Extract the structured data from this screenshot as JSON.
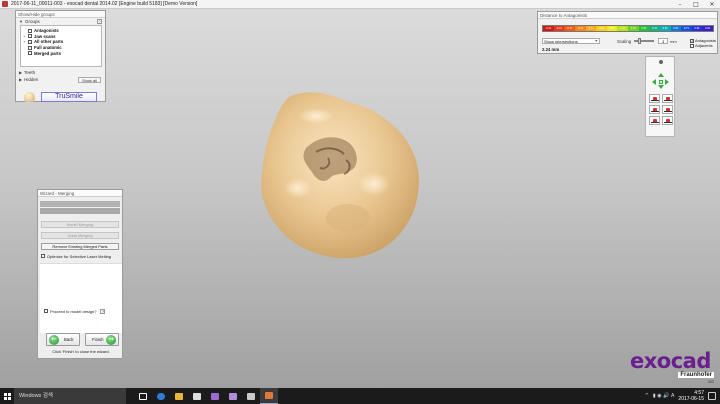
{
  "window": {
    "title": "2017-06-11_00011-003 - exocad dental 2014.02 [Engine build 5183] [Demo Version]",
    "minimize": "–",
    "maximize": "□",
    "close": "✕"
  },
  "showhide": {
    "title": "Show/Hide groups",
    "groups_label": "Groups",
    "help": "?",
    "groups": [
      {
        "label": "Antagonists",
        "expand": ""
      },
      {
        "label": "Jaw scans",
        "expand": "+"
      },
      {
        "label": "All other parts",
        "expand": "+"
      },
      {
        "label": "Full anatomic",
        "expand": ""
      },
      {
        "label": "Merged parts",
        "expand": ""
      }
    ],
    "teeth_label": "Teeth",
    "hidden_label": "Hidden",
    "show_all": "Show all",
    "trusmile": "TruSmile"
  },
  "distance": {
    "title": "Distance to Antagonists",
    "scale": [
      {
        "label": "-0.41",
        "color": "#d11818"
      },
      {
        "label": "-0.41",
        "color": "#e2361d"
      },
      {
        "label": "-0.31",
        "color": "#ef5a1c"
      },
      {
        "label": "-0.21",
        "color": "#f5831f"
      },
      {
        "label": "-0.11",
        "color": "#f8a81f"
      },
      {
        "label": "-0.01",
        "color": "#f6cd1e"
      },
      {
        "label": "0.01",
        "color": "#eeea1f"
      },
      {
        "label": "0.11",
        "color": "#b6e21f"
      },
      {
        "label": "0.21",
        "color": "#6fd02a"
      },
      {
        "label": "0.31",
        "color": "#27bf3d"
      },
      {
        "label": "0.41",
        "color": "#14b17a"
      },
      {
        "label": "0.51",
        "color": "#12a8b4"
      },
      {
        "label": "0.61",
        "color": "#1578d4"
      },
      {
        "label": "0.71",
        "color": "#1850e0"
      },
      {
        "label": "0.81",
        "color": "#2a2fe0"
      },
      {
        "label": "0.91",
        "color": "#3a1fc8"
      }
    ],
    "select_value": "Show intersections",
    "scaling_label": "Scaling",
    "scaling_value": "3",
    "unit": "mm",
    "scaling_fraction": 0.25,
    "antagonists": "Antagonists",
    "adjacents": "Adjacents",
    "check_mark": "✓",
    "distance_value": "2.24 mm"
  },
  "wizard": {
    "title": "Wizard - Merging",
    "btn_model": "Model Merging",
    "btn_undo": "Undo Merging",
    "btn_remove": "Remove Existing Merged Parts",
    "optimize": "Optimize for Selective Laser Melting",
    "proceed": "Proceed to model design?",
    "back": "Back",
    "finish": "Finish",
    "back_arrow": "←",
    "finish_arrow": "→",
    "help_text": "Click 'Finish' to close the wizard."
  },
  "logo": {
    "text": "exocad",
    "sub": "Fraunhofer",
    "sub2": "IGD"
  },
  "taskbar": {
    "search": "Windows 검색",
    "time": "4:57",
    "date": "2017-06-15",
    "tray_arrow": "^",
    "tray_icons": "▮ ◉ 🔊 A"
  }
}
